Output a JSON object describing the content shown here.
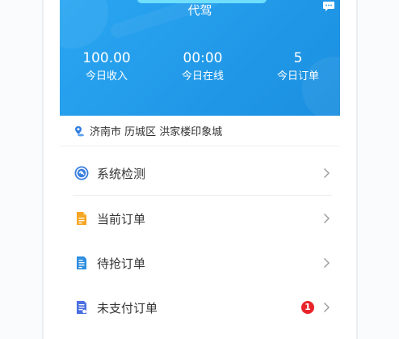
{
  "header": {
    "title": "代驾",
    "message_icon": "chat-bubble-icon",
    "stats": [
      {
        "value": "100.00",
        "label": "今日收入"
      },
      {
        "value": "00:00",
        "label": "今日在线"
      },
      {
        "value": "5",
        "label": "今日订单"
      }
    ]
  },
  "location": {
    "icon": "location-pin-icon",
    "address": "济南市 历城区 洪家楼印象城"
  },
  "menu": [
    {
      "label": "系统检测",
      "icon": "system-check-icon"
    },
    {
      "label": "当前订单",
      "icon": "current-order-icon"
    },
    {
      "label": "待抢订单",
      "icon": "pending-order-icon"
    },
    {
      "label": "未支付订单",
      "icon": "unpaid-order-icon",
      "badge": "1"
    }
  ],
  "colors": {
    "header_blue": "#1b8fe0",
    "badge_red": "#e8242b",
    "icon_orange": "#f5a623",
    "icon_blue": "#2f7de1"
  }
}
